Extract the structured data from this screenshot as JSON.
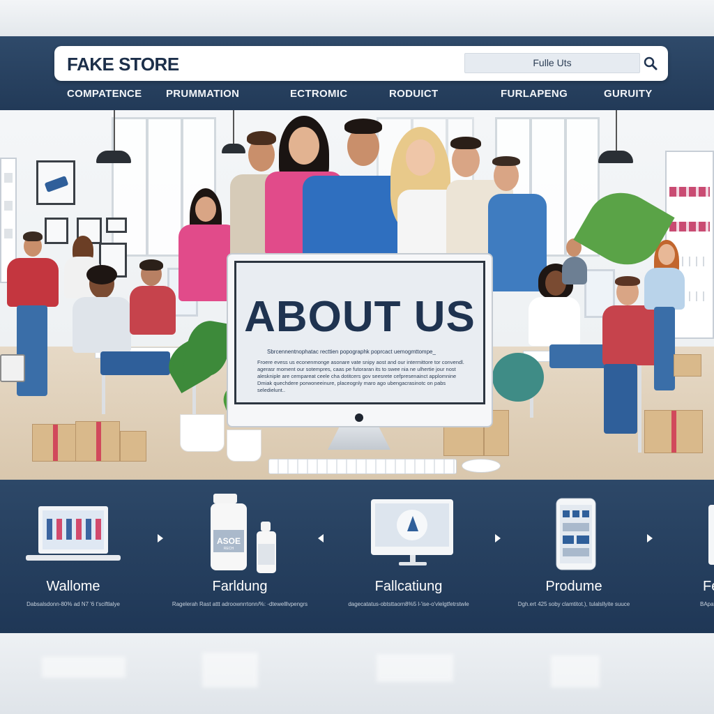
{
  "store": {
    "logo": "FAKE STORE"
  },
  "search": {
    "value": "Fulle Uts",
    "icon": "search-icon"
  },
  "nav": [
    {
      "label": "COMPATENCE"
    },
    {
      "label": "PRUMMATION"
    },
    {
      "label": "ECTROMIC"
    },
    {
      "label": "RODUICT"
    },
    {
      "label": "FURLAPENG"
    },
    {
      "label": "GURUITY"
    }
  ],
  "hero": {
    "title": "ABOUT  US",
    "subtitle": "Sbrcennentnophatac recttien popographk poprcact uemogmttompe_",
    "body": "Froere evess us econenmonge asonare vate snipy aost and our intermittore tor convendl. agerasr moment our sotempres, caas pe futoraran its to swee nia ne ulhertie jour nost aleskniple are cempareat ceele cha dotitcers gov seesrete cefpresenainct applomnine Dmiak quechdere porwoneeinure, placeognly maro ago ubengacrasinotc on pabs seledielunt.."
  },
  "features": [
    {
      "title": "Wallome",
      "desc": "Dabsalsdonn-80% ad N7 '6 t'sciftlalye",
      "icon": "laptop-icon"
    },
    {
      "title": "Farldung",
      "desc": "Ragelerah Rast attt adroownrrtonn/%: -dtewelllvpengrs",
      "icon": "bottle-icon"
    },
    {
      "title": "Fallcatiung",
      "desc": "dagecatatus-obtsttaorn8%5 l-'ise-o'vlelgtfetrstwle",
      "icon": "monitor-icon"
    },
    {
      "title": "Produme",
      "desc": "Dgh.ert 425 soby clamtitot.), tulalsllyite suuce",
      "icon": "phone-icon"
    },
    {
      "title": "Fe",
      "desc": "BApatit%/",
      "icon": "device-icon"
    }
  ],
  "colors": {
    "header": "#2f4a6a",
    "features": "#223a58",
    "title": "#1f3350",
    "accent_pink": "#e14b8a"
  }
}
